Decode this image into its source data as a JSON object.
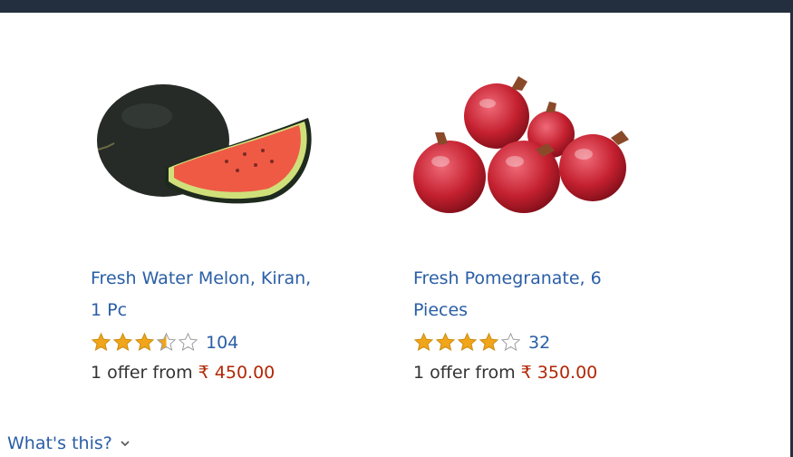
{
  "products": [
    {
      "title_line1": "Fresh Water Melon, Kiran,",
      "title_line2": "1 Pc",
      "rating": 3.5,
      "review_count": "104",
      "offer_prefix": "1 offer from ",
      "price": "₹ 450.00",
      "image": "watermelon"
    },
    {
      "title_line1": "Fresh Pomegranate, 6",
      "title_line2": "Pieces",
      "rating": 4,
      "review_count": "32",
      "offer_prefix": "1 offer from ",
      "price": "₹ 350.00",
      "image": "pomegranates"
    }
  ],
  "footer": {
    "whats_this": "What's this?"
  },
  "colors": {
    "link": "#2a5ea6",
    "price": "#b12704",
    "star": "#f1a51a",
    "topbar": "#232f3e"
  }
}
